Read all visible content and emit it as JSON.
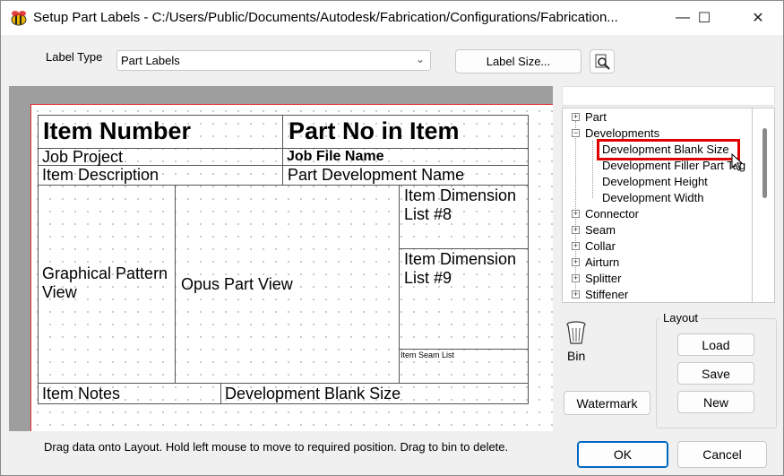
{
  "window": {
    "title": "Setup Part Labels - C:/Users/Public/Documents/Autodesk/Fabrication/Configurations/Fabrication...",
    "minimize": "—",
    "maximize": "☐",
    "close": "✕"
  },
  "form": {
    "label_type_label": "Label Type",
    "label_type_value": "Part Labels",
    "label_size_button": "Label Size..."
  },
  "layout_canvas": {
    "cells": {
      "item_number": "Item Number",
      "part_no_in_item": "Part No in Item",
      "job_project": "Job Project",
      "job_file_name": "Job File Name",
      "item_description": "Item Description",
      "part_development_name": "Part Development Name",
      "graphical_pattern_view_1": "Graphical Pattern",
      "graphical_pattern_view_2": "View",
      "opus_part_view": "Opus Part View",
      "item_dimension_8_line1": "Item Dimension",
      "item_dimension_8_line2": "List #8",
      "item_dimension_9_line1": "Item Dimension",
      "item_dimension_9_line2": "List #9",
      "item_seam_list": "Item Seam List",
      "item_notes": "Item Notes",
      "development_blank_size": "Development Blank Size"
    }
  },
  "tree": {
    "items": [
      {
        "label": "Part",
        "expander": "+"
      },
      {
        "label": "Developments",
        "expander": "−"
      },
      {
        "label": "Development Blank Size"
      },
      {
        "label": "Development Filler Part Tag"
      },
      {
        "label": "Development Height"
      },
      {
        "label": "Development Width"
      },
      {
        "label": "Connector",
        "expander": "+"
      },
      {
        "label": "Seam",
        "expander": "+"
      },
      {
        "label": "Collar",
        "expander": "+"
      },
      {
        "label": "Airturn",
        "expander": "+"
      },
      {
        "label": "Splitter",
        "expander": "+"
      },
      {
        "label": "Stiffener",
        "expander": "+"
      }
    ]
  },
  "bin": {
    "label": "Bin",
    "icon": "trash-bin-icon"
  },
  "buttons": {
    "watermark": "Watermark",
    "layout_group": "Layout",
    "load": "Load",
    "save": "Save",
    "new": "New",
    "ok": "OK",
    "cancel": "Cancel"
  },
  "status_text": "Drag data onto Layout. Hold left mouse to move to required position. Drag to bin to delete.",
  "colors": {
    "accent": "#0067c0",
    "selection_highlight": "#e00000",
    "canvas_background": "#9e9e9e",
    "canvas_border": "#e23232"
  }
}
